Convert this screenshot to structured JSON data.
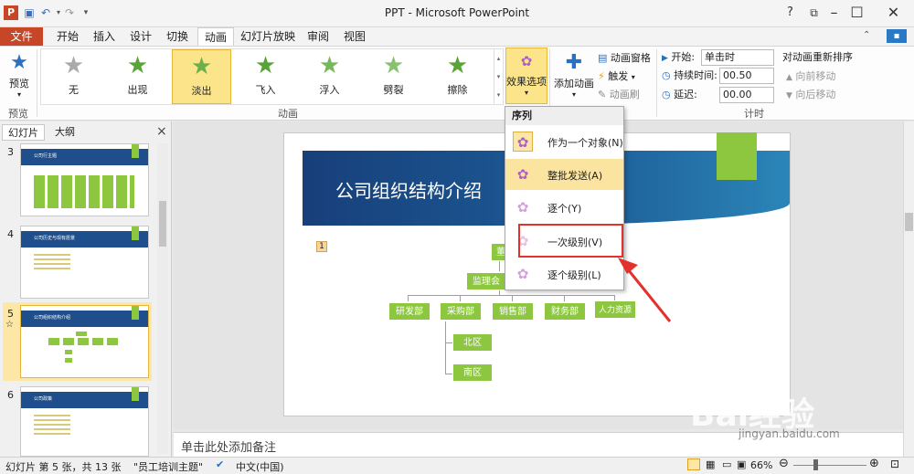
{
  "window": {
    "title": "PPT - Microsoft PowerPoint",
    "app_icon_letter": "P"
  },
  "tabs": [
    "文件",
    "开始",
    "插入",
    "设计",
    "切换",
    "动画",
    "幻灯片放映",
    "审阅",
    "视图"
  ],
  "ribbon": {
    "preview_label": "预览",
    "preview_group": "预览",
    "animation_group": "动画",
    "gallery": [
      "无",
      "出现",
      "淡出",
      "飞入",
      "浮入",
      "劈裂",
      "擦除"
    ],
    "effect_options": "效果选项",
    "add_animation": "添加动画",
    "animation_pane": "动画窗格",
    "trigger": "触发",
    "animation_painter": "动画刷",
    "start_label": "开始:",
    "start_value": "单击时",
    "duration_label": "持续时间:",
    "duration_value": "00.50",
    "delay_label": "延迟:",
    "delay_value": "00.00",
    "reorder_title": "对动画重新排序",
    "move_earlier": "向前移动",
    "move_later": "向后移动",
    "timing_group": "计时"
  },
  "pane_tabs": {
    "slides": "幻灯片",
    "outline": "大纲",
    "close_glyph": "×"
  },
  "thumbnails": [
    {
      "num": "3",
      "title": "公司行主题"
    },
    {
      "num": "4",
      "title": "公司历史与现有愿景"
    },
    {
      "num": "5",
      "title": "公司组织结构介绍"
    },
    {
      "num": "6",
      "title": "公司政策"
    }
  ],
  "slide": {
    "title": "公司组织结构介绍",
    "anim_marker": "1",
    "nodes": {
      "top": "董",
      "supervisor": "监理会",
      "rd": "研发部",
      "purchase": "采购部",
      "sales": "销售部",
      "finance": "财务部",
      "hr": "人力资源部",
      "north": "北区",
      "south": "南区"
    }
  },
  "dropdown": {
    "header": "序列",
    "items": [
      "作为一个对象(N)",
      "整批发送(A)",
      "逐个(Y)",
      "一次级别(V)",
      "逐个级别(L)"
    ]
  },
  "notes_placeholder": "单击此处添加备注",
  "status": {
    "slide_info": "幻灯片 第 5 张，共 13 张",
    "theme": "\"员工培训主题\"",
    "language": "中文(中国)",
    "zoom": "66%"
  },
  "watermark": {
    "brand": "Bai经验",
    "url": "jingyan.baidu.com"
  },
  "colors": {
    "accent_green": "#8dc63f",
    "slide_blue": "#1e4f8c",
    "file_tab": "#c74628",
    "highlight": "#fbe48a",
    "annotation_red": "#e3322e"
  }
}
